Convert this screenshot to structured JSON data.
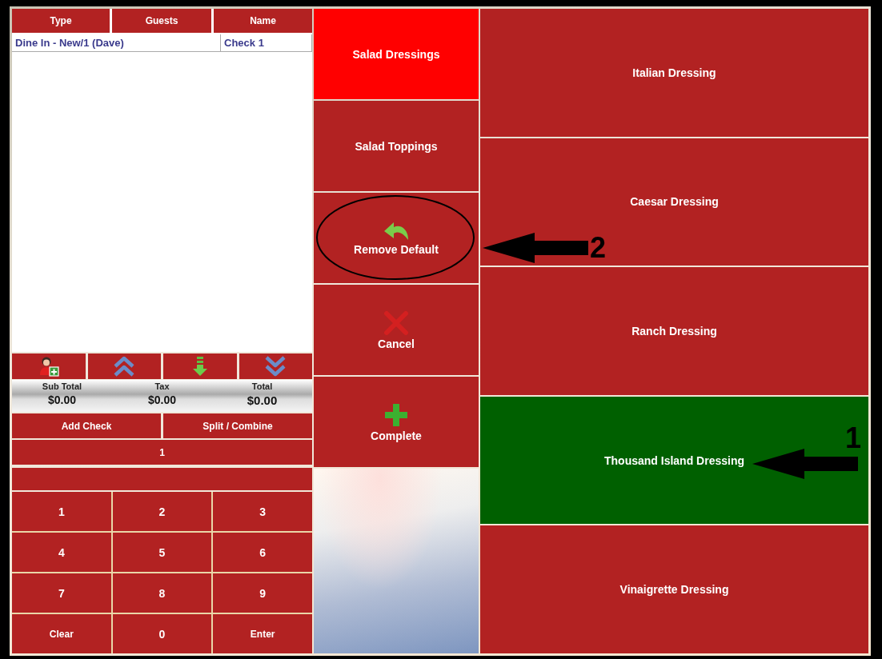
{
  "order_list": {
    "columns": [
      "Type",
      "Guests",
      "Name"
    ],
    "rows": [
      {
        "type": "Dine In - New/1 (Dave)",
        "name": "Check 1"
      }
    ]
  },
  "icon_buttons": [
    {
      "kind": "add-guest"
    },
    {
      "kind": "page-up"
    },
    {
      "kind": "move-down"
    },
    {
      "kind": "page-down"
    }
  ],
  "totals": [
    {
      "label": "Sub Total",
      "value": "$0.00"
    },
    {
      "label": "Tax",
      "value": "$0.00"
    },
    {
      "label": "Total",
      "value": "$0.00"
    }
  ],
  "check_buttons": [
    "Add Check",
    "Split / Combine"
  ],
  "check_number": "1",
  "keypad": [
    "1",
    "2",
    "3",
    "4",
    "5",
    "6",
    "7",
    "8",
    "9",
    "Clear",
    "0",
    "Enter"
  ],
  "categories": [
    {
      "label": "Salad Dressings",
      "selected": true
    },
    {
      "label": "Salad Toppings",
      "selected": false
    }
  ],
  "actions": [
    {
      "label": "Remove Default",
      "kind": "undo",
      "circled": true
    },
    {
      "label": "Cancel",
      "kind": "cancel",
      "circled": false
    },
    {
      "label": "Complete",
      "kind": "add",
      "circled": false
    }
  ],
  "items": [
    {
      "label": "Italian Dressing",
      "selected": false
    },
    {
      "label": "Caesar Dressing",
      "selected": false
    },
    {
      "label": "Ranch Dressing",
      "selected": false
    },
    {
      "label": "Thousand Island Dressing",
      "selected": true
    },
    {
      "label": "Vinaigrette Dressing",
      "selected": false
    }
  ],
  "annotations": [
    {
      "label": "2",
      "kind": "arrow"
    },
    {
      "label": "1",
      "kind": "arrow"
    }
  ]
}
